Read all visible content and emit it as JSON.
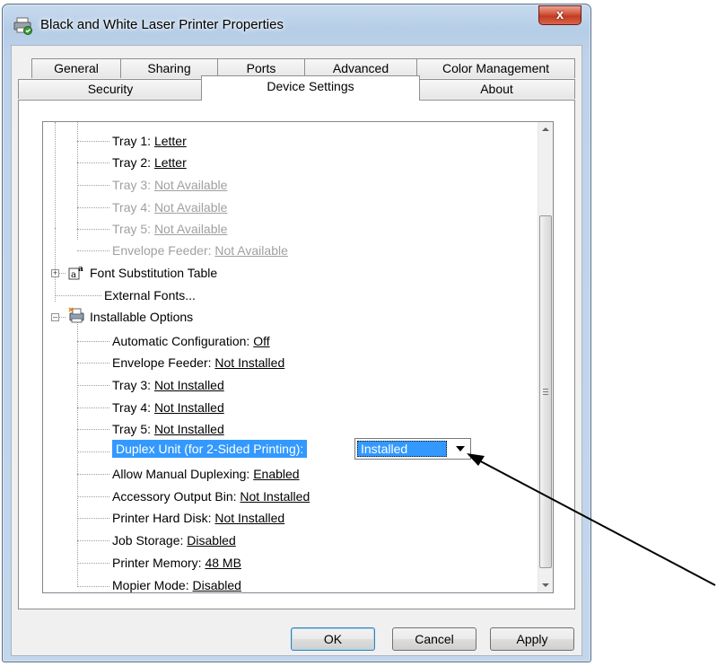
{
  "window": {
    "title": "Black and  White Laser Printer Properties",
    "close_glyph": "x"
  },
  "tabs_row1": [
    {
      "label": "General"
    },
    {
      "label": "Sharing"
    },
    {
      "label": "Ports"
    },
    {
      "label": "Advanced"
    },
    {
      "label": "Color Management"
    }
  ],
  "tabs_row2": [
    {
      "label": "Security"
    },
    {
      "label": "Device Settings",
      "active": true
    },
    {
      "label": "About"
    }
  ],
  "tree": {
    "trays": [
      {
        "label": "Tray 1: ",
        "value": "Letter",
        "enabled": true
      },
      {
        "label": "Tray 2: ",
        "value": "Letter",
        "enabled": true
      },
      {
        "label": "Tray 3: ",
        "value": "Not Available",
        "enabled": false
      },
      {
        "label": "Tray 4: ",
        "value": "Not Available",
        "enabled": false
      },
      {
        "label": "Tray 5: ",
        "value": "Not Available",
        "enabled": false
      },
      {
        "label": "Envelope Feeder: ",
        "value": "Not Available",
        "enabled": false
      }
    ],
    "font_substitution": "Font Substitution Table",
    "external_fonts": "External Fonts...",
    "installable_options": "Installable Options",
    "options": [
      {
        "label": "Automatic Configuration: ",
        "value": "Off"
      },
      {
        "label": "Envelope Feeder: ",
        "value": "Not Installed"
      },
      {
        "label": "Tray 3: ",
        "value": "Not Installed"
      },
      {
        "label": "Tray 4: ",
        "value": "Not Installed"
      },
      {
        "label": "Tray 5: ",
        "value": "Not Installed"
      },
      {
        "label": "Duplex Unit (for 2-Sided Printing):",
        "value": "",
        "selected": true
      },
      {
        "label": "Allow Manual Duplexing: ",
        "value": "Enabled"
      },
      {
        "label": "Accessory Output Bin: ",
        "value": "Not Installed"
      },
      {
        "label": "Printer Hard Disk: ",
        "value": "Not Installed"
      },
      {
        "label": "Job Storage: ",
        "value": "Disabled"
      },
      {
        "label": "Printer Memory: ",
        "value": "48 MB"
      },
      {
        "label": "Mopier Mode: ",
        "value": "Disabled"
      }
    ],
    "duplex_dropdown": {
      "selected": "Installed"
    }
  },
  "buttons": {
    "ok": "OK",
    "cancel": "Cancel",
    "apply": "Apply"
  },
  "scrollbar": {
    "position_fraction": 0.2
  }
}
